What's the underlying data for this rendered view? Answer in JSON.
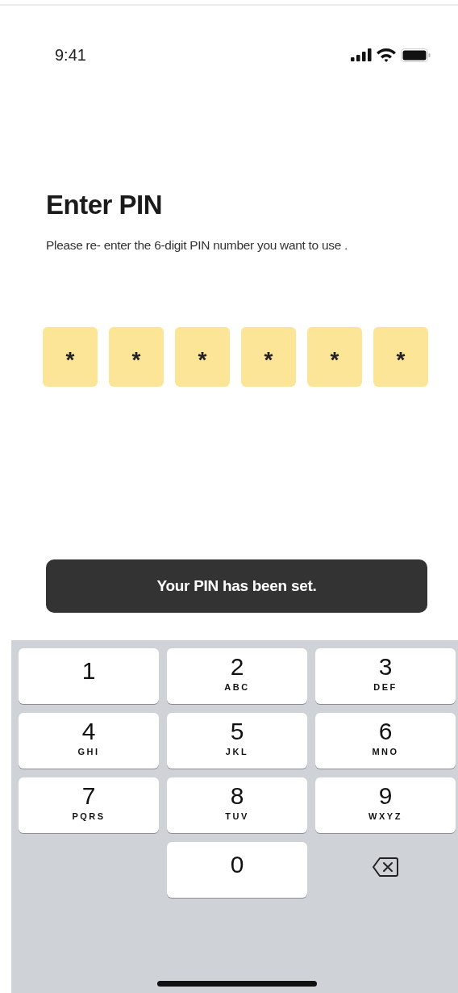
{
  "status_bar": {
    "time": "9:41"
  },
  "title": "Enter PIN",
  "subtitle": "Please re- enter the 6-digit PIN number you want to use .",
  "pin_boxes": [
    {
      "value": "*",
      "filled": true
    },
    {
      "value": "*",
      "filled": true
    },
    {
      "value": "*",
      "filled": true
    },
    {
      "value": "*",
      "filled": true
    },
    {
      "value": "*",
      "filled": true
    },
    {
      "value": "*",
      "filled": true
    }
  ],
  "toast": {
    "message": "Your PIN has been set."
  },
  "keypad": [
    {
      "kind": "digit",
      "digit": "1"
    },
    {
      "kind": "digit",
      "digit": "2",
      "letters": "ABC"
    },
    {
      "kind": "digit",
      "digit": "3",
      "letters": "DEF"
    },
    {
      "kind": "digit",
      "digit": "4",
      "letters": "GHI"
    },
    {
      "kind": "digit",
      "digit": "5",
      "letters": "JKL"
    },
    {
      "kind": "digit",
      "digit": "6",
      "letters": "MNO"
    },
    {
      "kind": "digit",
      "digit": "7",
      "letters": "PQRS"
    },
    {
      "kind": "digit",
      "digit": "8",
      "letters": "TUV"
    },
    {
      "kind": "digit",
      "digit": "9",
      "letters": "WXYZ"
    },
    {
      "kind": "blank"
    },
    {
      "kind": "digit",
      "digit": "0"
    },
    {
      "kind": "delete"
    }
  ]
}
